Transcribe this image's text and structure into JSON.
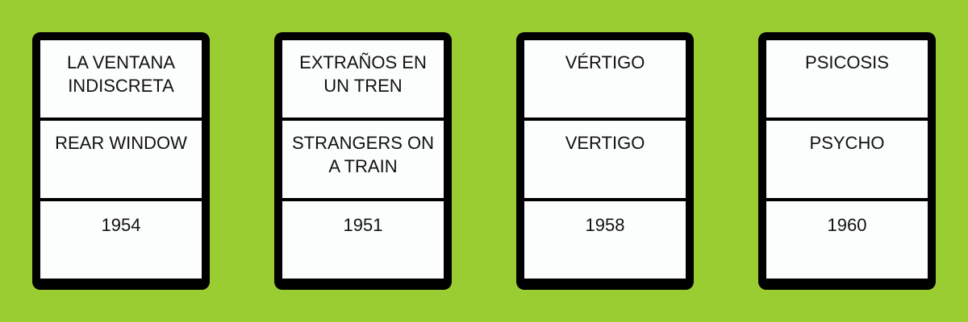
{
  "cards": [
    {
      "spanish_title": "LA VENTANA INDISCRETA",
      "english_title": "REAR WINDOW",
      "year": "1954"
    },
    {
      "spanish_title": "EXTRAÑOS EN UN TREN",
      "english_title": "STRANGERS ON A TRAIN",
      "year": "1951"
    },
    {
      "spanish_title": "VÉRTIGO",
      "english_title": "VERTIGO",
      "year": "1958"
    },
    {
      "spanish_title": "PSICOSIS",
      "english_title": "PSYCHO",
      "year": "1960"
    }
  ]
}
